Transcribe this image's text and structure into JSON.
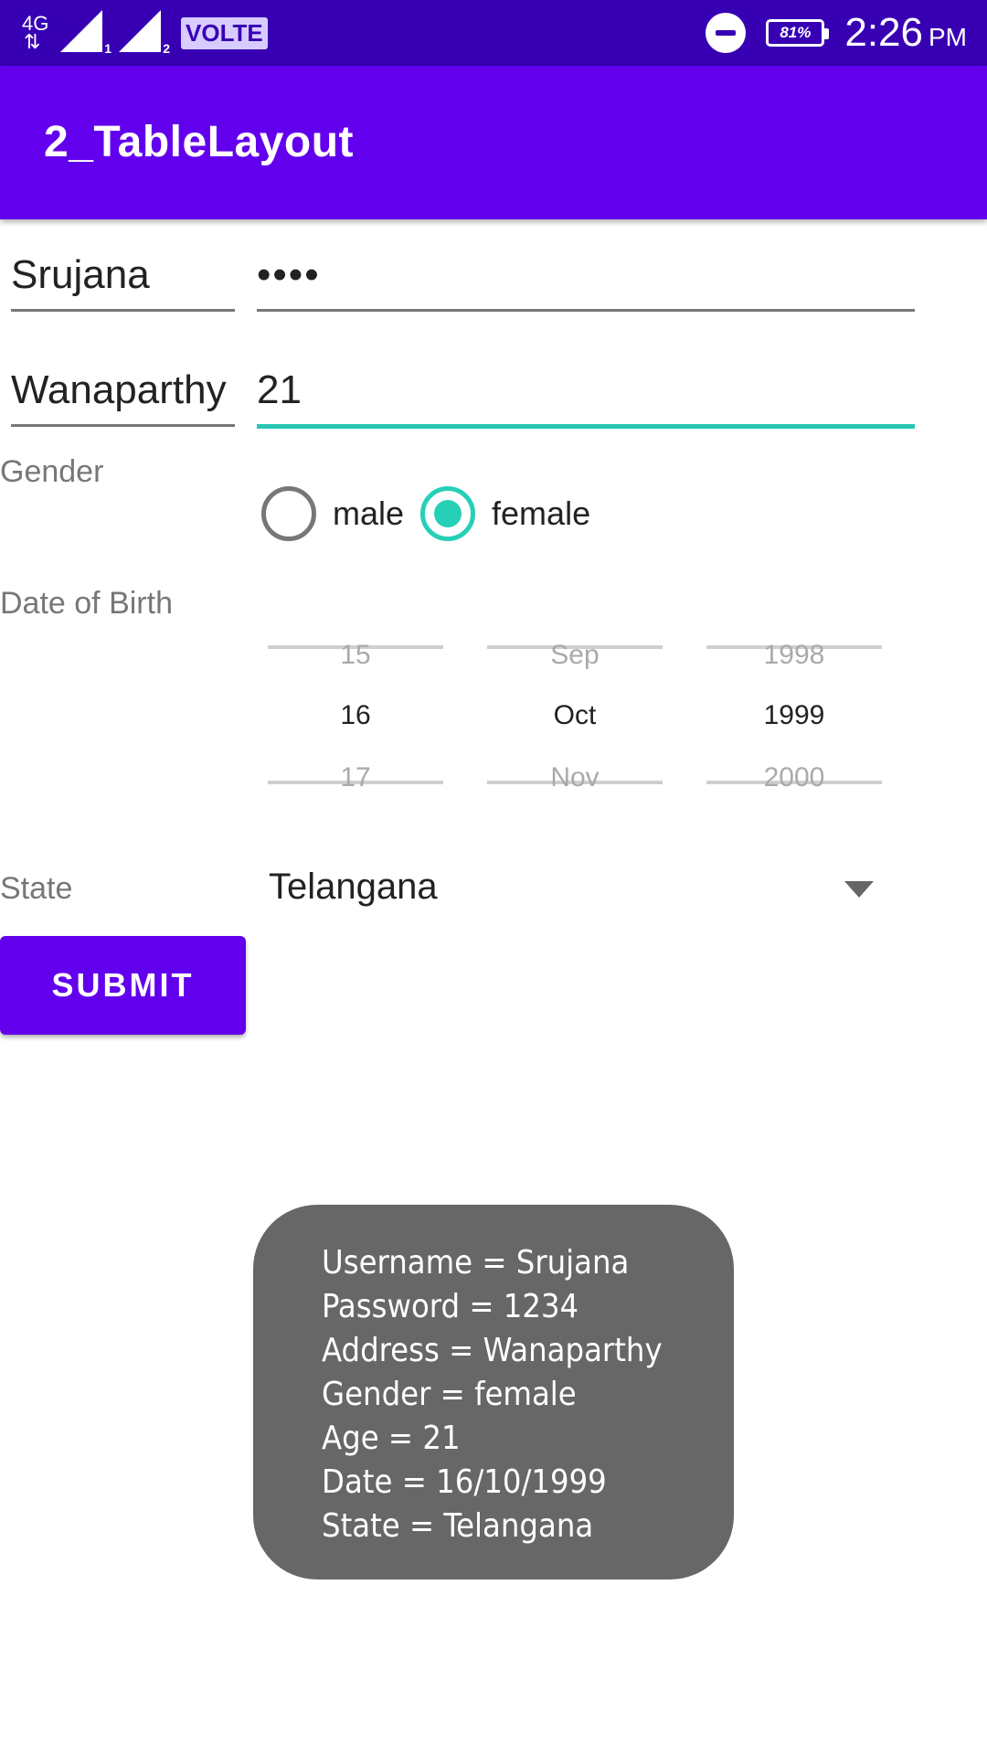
{
  "status_bar": {
    "network": "4G",
    "sim1_label": "1",
    "sim2_label": "2",
    "volte": "VOLTE",
    "battery": "81%",
    "time": "2:26",
    "ampm": "PM",
    "icons": [
      "network-4g-icon",
      "signal-icon",
      "signal-icon",
      "volte-icon",
      "do-not-disturb-icon",
      "battery-icon"
    ]
  },
  "app_bar": {
    "title": "2_TableLayout"
  },
  "form": {
    "username": "Srujana",
    "password": "••••",
    "address": "Wanaparthy",
    "age": "21",
    "gender_label": "Gender",
    "gender_options": [
      {
        "label": "male",
        "checked": false
      },
      {
        "label": "female",
        "checked": true
      }
    ],
    "dob_label": "Date of Birth",
    "date_picker": {
      "day": {
        "prev": "15",
        "current": "16",
        "next": "17"
      },
      "month": {
        "prev": "Sep",
        "current": "Oct",
        "next": "Nov"
      },
      "year": {
        "prev": "1998",
        "current": "1999",
        "next": "2000"
      }
    },
    "state_label": "State",
    "state_value": "Telangana",
    "submit_label": "SUBMIT"
  },
  "toast": {
    "lines": [
      "Username = Srujana",
      "Password = 1234",
      "Address = Wanaparthy",
      "Gender = female",
      "Age = 21",
      "Date = 16/10/1999",
      "State = Telangana"
    ]
  },
  "colors": {
    "status_bar": "#3700b3",
    "primary": "#6200ee",
    "accent": "#26d0b7",
    "toast_bg": "#676767"
  }
}
